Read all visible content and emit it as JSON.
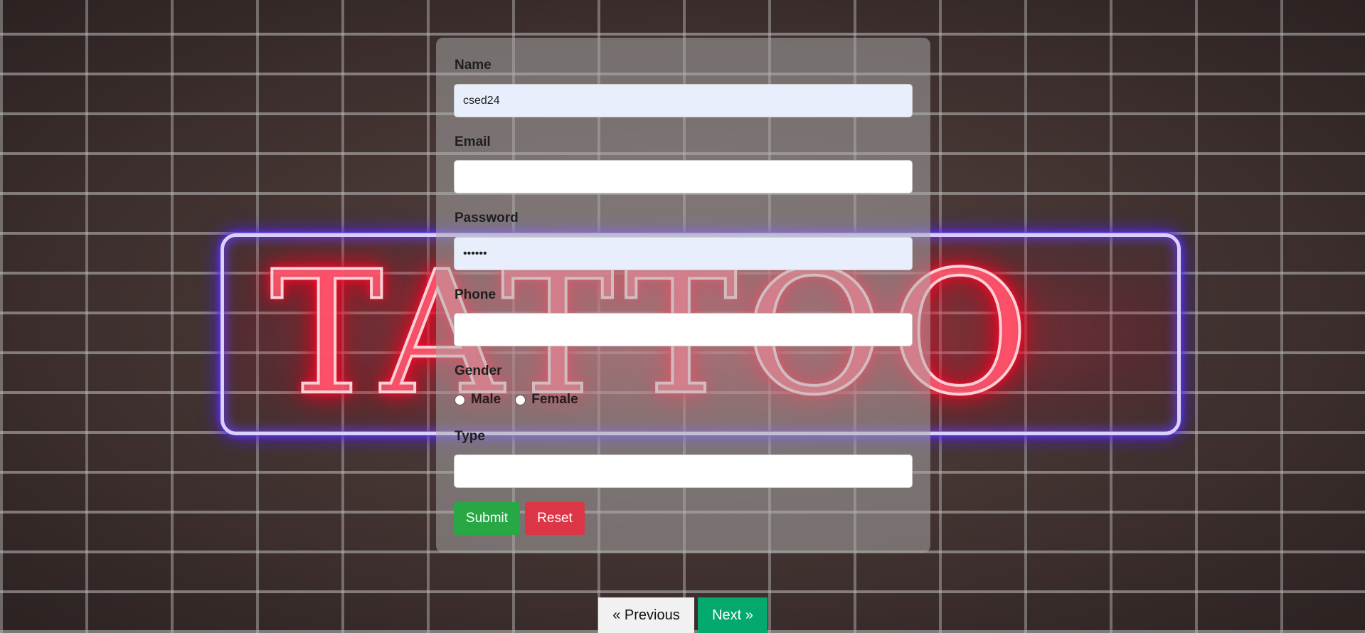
{
  "background": {
    "sign_text": "TATTOO"
  },
  "form": {
    "name_label": "Name",
    "name_value": "csed24",
    "email_label": "Email",
    "email_value": "",
    "password_label": "Password",
    "password_value": "••••••",
    "phone_label": "Phone",
    "phone_value": "",
    "gender_label": "Gender",
    "gender_options": [
      "Male",
      "Female"
    ],
    "type_label": "Type",
    "type_value": "",
    "submit_label": "Submit",
    "reset_label": "Reset"
  },
  "pagination": {
    "previous_label": "« Previous",
    "next_label": "Next »"
  },
  "colors": {
    "submit": "#28a745",
    "reset": "#dc3545",
    "next": "#04aa6d",
    "previous": "#f1f1f1"
  }
}
